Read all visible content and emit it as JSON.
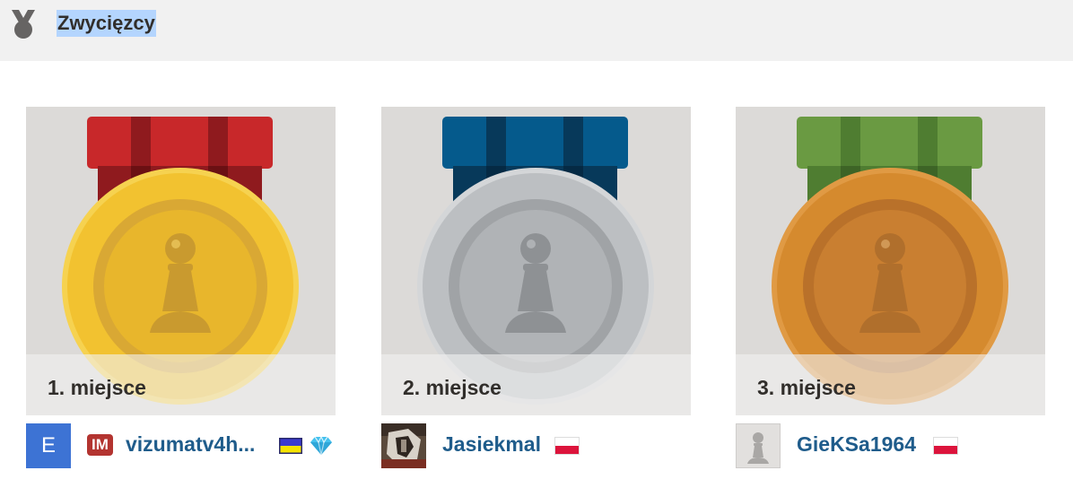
{
  "header": {
    "title": "Zwycięzcy",
    "icon": "medal-icon",
    "icon_color": "#666463",
    "title_highlight": "#b4d5fe"
  },
  "podium": [
    {
      "place_label": "1. miejsce",
      "medal": "gold-medal",
      "ribbon_color": "#c8282a",
      "medal_color": "#f2c230",
      "player": {
        "avatar_letter": "E",
        "title": "IM",
        "username": "vizumatv4h...",
        "flag": "flag-ukraine",
        "badge": "diamond-membership-icon"
      }
    },
    {
      "place_label": "2. miejsce",
      "medal": "silver-medal",
      "ribbon_color": "#055a8c",
      "medal_color": "#bcbfc2",
      "player": {
        "avatar": "user-photo-avatar",
        "username": "Jasiekmal",
        "flag": "flag-poland"
      }
    },
    {
      "place_label": "3. miejsce",
      "medal": "bronze-medal",
      "ribbon_color": "#6a9a42",
      "medal_color": "#d58a2e",
      "player": {
        "avatar": "default-pawn-avatar",
        "username": "GieKSa1964",
        "flag": "flag-poland"
      }
    }
  ]
}
